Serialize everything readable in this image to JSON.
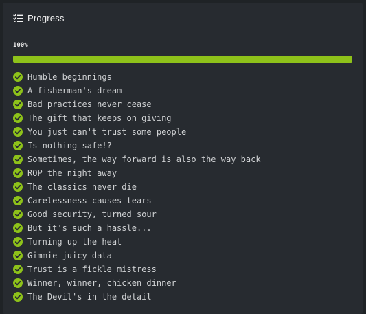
{
  "header": {
    "title": "Progress",
    "icon": "checklist-icon"
  },
  "progress": {
    "label": "100%",
    "value": 100,
    "color": "#8ec21a"
  },
  "tasks": [
    {
      "label": "Humble beginnings",
      "done": true
    },
    {
      "label": "A fisherman's dream",
      "done": true
    },
    {
      "label": "Bad practices never cease",
      "done": true
    },
    {
      "label": "The gift that keeps on giving",
      "done": true
    },
    {
      "label": "You just can't trust some people",
      "done": true
    },
    {
      "label": "Is nothing safe!?",
      "done": true
    },
    {
      "label": "Sometimes, the way forward is also the way back",
      "done": true
    },
    {
      "label": "ROP the night away",
      "done": true
    },
    {
      "label": "The classics never die",
      "done": true
    },
    {
      "label": "Carelessness causes tears",
      "done": true
    },
    {
      "label": "Good security, turned sour",
      "done": true
    },
    {
      "label": "But it's such a hassle...",
      "done": true
    },
    {
      "label": "Turning up the heat",
      "done": true
    },
    {
      "label": "Gimmie juicy data",
      "done": true
    },
    {
      "label": "Trust is a fickle mistress",
      "done": true
    },
    {
      "label": "Winner, winner, chicken dinner",
      "done": true
    },
    {
      "label": "The Devil's in the detail",
      "done": true
    }
  ],
  "check_icon": "check-circle-icon",
  "check_color": "#8ec21a"
}
